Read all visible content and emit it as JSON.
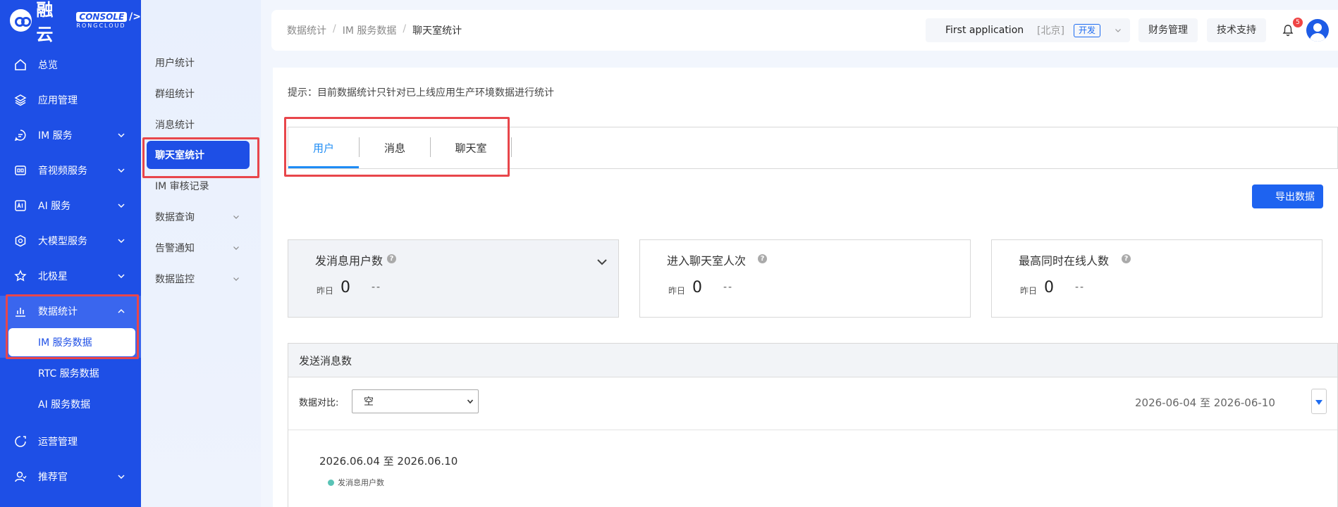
{
  "brand": {
    "name": "融云",
    "console": "CONSOLE",
    "console_slash": "/>",
    "sub": "RONGCLOUD"
  },
  "sidebar": {
    "items": [
      {
        "label": "总览",
        "icon": "home-icon"
      },
      {
        "label": "应用管理",
        "icon": "layers-icon"
      },
      {
        "label": "IM 服务",
        "icon": "chat-icon"
      },
      {
        "label": "音视频服务",
        "icon": "video-icon"
      },
      {
        "label": "AI 服务",
        "icon": "ai-icon"
      },
      {
        "label": "大模型服务",
        "icon": "model-icon"
      },
      {
        "label": "北极星",
        "icon": "star-icon"
      },
      {
        "label": "数据统计",
        "icon": "bar-chart-icon"
      },
      {
        "label": "运营管理",
        "icon": "operations-icon"
      },
      {
        "label": "推荐官",
        "icon": "user-icon"
      }
    ],
    "sub_items": [
      {
        "label": "IM 服务数据"
      },
      {
        "label": "RTC 服务数据"
      },
      {
        "label": "AI 服务数据"
      }
    ]
  },
  "subnav": {
    "items": [
      {
        "label": "用户统计"
      },
      {
        "label": "群组统计"
      },
      {
        "label": "消息统计"
      },
      {
        "label": "聊天室统计"
      },
      {
        "label": "IM 审核记录"
      },
      {
        "label": "数据查询"
      },
      {
        "label": "告警通知"
      },
      {
        "label": "数据监控"
      }
    ]
  },
  "header": {
    "breadcrumb": [
      "数据统计",
      "IM 服务数据",
      "聊天室统计"
    ],
    "breadcrumb_sep": "/",
    "app_name": "First application",
    "region": "[北京]",
    "env": "开发",
    "finance": "财务管理",
    "support": "技术支持",
    "notification_count": "5"
  },
  "main": {
    "tip": "提示：目前数据统计只针对已上线应用生产环境数据进行统计",
    "tabs": [
      "用户",
      "消息",
      "聊天室"
    ],
    "export_label": "导出数据",
    "cards": [
      {
        "title": "发消息用户数",
        "yesterday_label": "昨日",
        "value": "0",
        "trend": "--"
      },
      {
        "title": "进入聊天室人次",
        "yesterday_label": "昨日",
        "value": "0",
        "trend": "--"
      },
      {
        "title": "最高同时在线人数",
        "yesterday_label": "昨日",
        "value": "0",
        "trend": "--"
      }
    ],
    "help_glyph": "?",
    "panel": {
      "title": "发送消息数",
      "compare_label": "数据对比:",
      "compare_value": "空",
      "date_range": "2026-06-04 至 2026-06-10",
      "chart_title": "2026.06.04 至 2026.06.10",
      "legend": "发消息用户数"
    }
  },
  "colors": {
    "brand": "#1e4fe6",
    "accent": "#1e8cf5",
    "highlight_box": "#e8464b",
    "legend_dot": "#59c3b6"
  }
}
